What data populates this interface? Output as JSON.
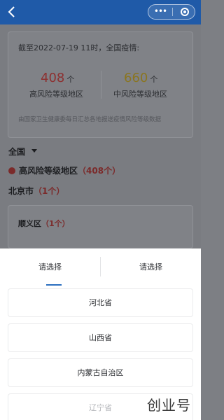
{
  "nav": {
    "more_glyph": "•••"
  },
  "stats": {
    "title": "截至2022-07-19 11时，全国疫情:",
    "high_count": "408",
    "mid_count": "660",
    "unit": "个",
    "high_label": "高风险等级地区",
    "mid_label": "中风险等级地区",
    "source": "由国家卫生健康委每日汇总各地报送疫情风险等级数据"
  },
  "filter": {
    "region": "全国"
  },
  "risk": {
    "title": "高风险等级地区",
    "count": "（408个）"
  },
  "city": {
    "name": "北京市",
    "count": "（1个）"
  },
  "district": {
    "name": "顺义区",
    "count": "（1个）"
  },
  "picker": {
    "tabs": [
      "请选择",
      "请选择"
    ],
    "options": [
      "河北省",
      "山西省",
      "内蒙古自治区",
      "辽宁省"
    ]
  },
  "watermark": "创业号",
  "colors": {
    "brand_blue": "#1f5aa8",
    "tab_active": "#2b6fbf",
    "high_risk": "#8d3030",
    "mid_risk": "#8a7520"
  }
}
